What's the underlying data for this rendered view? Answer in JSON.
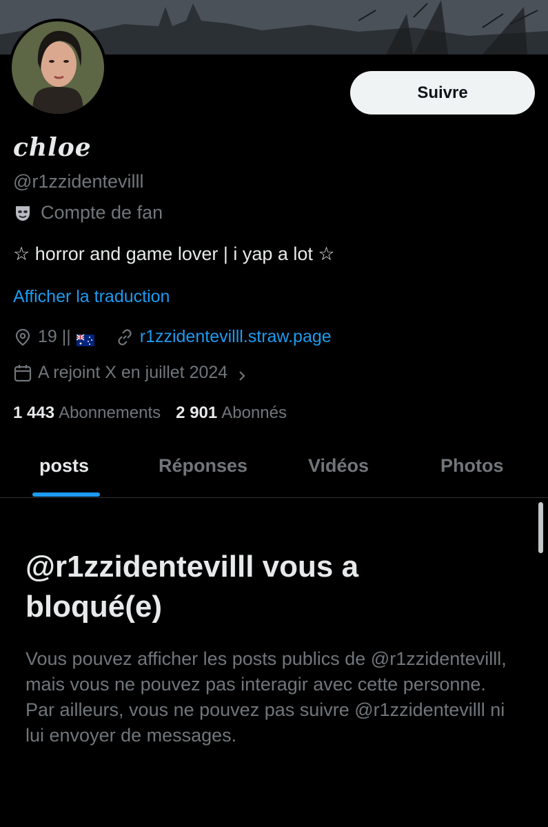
{
  "profile": {
    "display_name": "chloe",
    "handle": "@r1zzidentevilll",
    "account_type": "Compte de fan",
    "bio": "☆ horror and game lover | i yap a lot ☆",
    "translate_label": "Afficher la traduction",
    "location": "19 ||",
    "website": "r1zzidentevilll.straw.page",
    "joined": "A rejoint X en juillet 2024",
    "following_count": "1 443",
    "following_label": "Abonnements",
    "followers_count": "2 901",
    "followers_label": "Abonnés"
  },
  "actions": {
    "follow_label": "Suivre"
  },
  "tabs": [
    {
      "label": "posts",
      "active": true
    },
    {
      "label": "Réponses",
      "active": false
    },
    {
      "label": "Vidéos",
      "active": false
    },
    {
      "label": "Photos",
      "active": false
    }
  ],
  "blocked": {
    "title": "@r1zzidentevilll vous a bloqué(e)",
    "message": "Vous pouvez afficher les posts publics de @r1zzidentevilll, mais vous ne pouvez pas interagir avec cette personne. Par ailleurs, vous ne pouvez pas suivre @r1zzidentevilll ni lui envoyer de messages."
  },
  "icons": {
    "fan_account": "theater-mask-icon",
    "location": "location-pin-icon",
    "flag": "australia-flag-icon",
    "website": "link-icon",
    "joined": "calendar-icon",
    "joined_more": "chevron-right-icon"
  },
  "colors": {
    "background": "#000000",
    "accent": "#1d9bf0",
    "text_primary": "#e7e9ea",
    "text_secondary": "#71767b",
    "button_bg": "#eff3f4"
  }
}
